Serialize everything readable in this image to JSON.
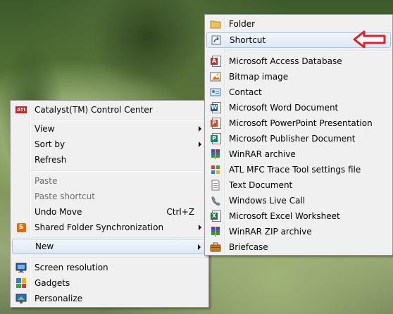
{
  "context_menu": {
    "items": [
      {
        "label": "Catalyst(TM) Control Center",
        "icon": "ati-icon"
      },
      {
        "label": "View",
        "submenu": true
      },
      {
        "label": "Sort by",
        "submenu": true
      },
      {
        "label": "Refresh"
      },
      {
        "label": "Paste",
        "disabled": true
      },
      {
        "label": "Paste shortcut",
        "disabled": true
      },
      {
        "label": "Undo Move",
        "shortcut": "Ctrl+Z"
      },
      {
        "label": "Shared Folder Synchronization",
        "icon": "sync-icon",
        "submenu": true
      },
      {
        "label": "New",
        "submenu": true,
        "highlighted": true
      },
      {
        "label": "Screen resolution",
        "icon": "monitor-icon"
      },
      {
        "label": "Gadgets",
        "icon": "gadgets-icon"
      },
      {
        "label": "Personalize",
        "icon": "personalize-icon"
      }
    ]
  },
  "new_submenu": {
    "items": [
      {
        "label": "Folder",
        "icon": "folder-icon"
      },
      {
        "label": "Shortcut",
        "icon": "shortcut-icon",
        "highlighted": true
      },
      {
        "label": "Microsoft Access Database",
        "icon": "access-icon"
      },
      {
        "label": "Bitmap image",
        "icon": "bitmap-icon"
      },
      {
        "label": "Contact",
        "icon": "contact-icon"
      },
      {
        "label": "Microsoft Word Document",
        "icon": "word-icon"
      },
      {
        "label": "Microsoft PowerPoint Presentation",
        "icon": "powerpoint-icon"
      },
      {
        "label": "Microsoft Publisher Document",
        "icon": "publisher-icon"
      },
      {
        "label": "WinRAR archive",
        "icon": "winrar-icon"
      },
      {
        "label": "ATL MFC Trace Tool settings file",
        "icon": "atl-icon"
      },
      {
        "label": "Text Document",
        "icon": "text-icon"
      },
      {
        "label": "Windows Live Call",
        "icon": "live-call-icon"
      },
      {
        "label": "Microsoft Excel Worksheet",
        "icon": "excel-icon"
      },
      {
        "label": "WinRAR ZIP archive",
        "icon": "winrar-zip-icon"
      },
      {
        "label": "Briefcase",
        "icon": "briefcase-icon"
      }
    ]
  },
  "colors": {
    "menu_bg": "#f0f0f0",
    "highlight_border": "#a8c7ec",
    "callout_arrow": "#e0202a"
  }
}
